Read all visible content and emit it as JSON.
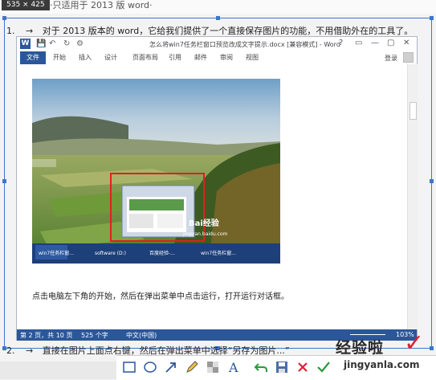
{
  "header": {
    "size_badge": "535 × 425",
    "caption": "·只适用于 2013 版 word·"
  },
  "steps": [
    {
      "num": "1.",
      "arrow": "→",
      "text": "对于 2013 版本的 word，它给我们提供了一个直接保存图片的功能，不用借助外在的工具了。"
    },
    {
      "num": "2.",
      "arrow": "→",
      "text": "直接在图片上面点右键，然后在弹出菜单中选择“另存为图片...”"
    }
  ],
  "word": {
    "logo": "W",
    "quick_access": [
      "💾",
      "↶",
      "↻",
      "⚙"
    ],
    "title": "怎么将win7任务栏窗口预览改成文字提示.docx [兼容模式] - Word",
    "window_controls": [
      "?",
      "▭",
      "—",
      "▢",
      "✕"
    ],
    "tabs": [
      "文件",
      "开始",
      "插入",
      "设计",
      "页面布局",
      "引用",
      "邮件",
      "审阅",
      "视图"
    ],
    "login": "登录",
    "taskbar_items": [
      "win7任务栏窗...",
      "software (D:)",
      "百度经验-...",
      "win7任务栏窗..."
    ],
    "photo_watermark": "Bai经验",
    "photo_site": "jingyan.baidu.com",
    "paragraph": "点击电脑左下角的开始，然后在弹出菜单中点击运行，打开运行对话框。",
    "status": {
      "page": "第 2 页，共 10 页",
      "words": "525 个字",
      "language": "中文(中国)",
      "zoom": "103%"
    }
  },
  "watermark": {
    "brand": "经验啦",
    "check": "✓",
    "url": "jingyanla.com"
  },
  "colors": {
    "word_blue": "#2b579a",
    "selection_blue": "#3c78c8",
    "highlight_red": "#e02020"
  },
  "toolbar_icons": [
    "rectangle-icon",
    "ellipse-icon",
    "arrow-icon",
    "pencil-icon",
    "mosaic-icon",
    "text-icon",
    "undo-icon",
    "save-icon",
    "close-icon",
    "confirm-icon"
  ]
}
